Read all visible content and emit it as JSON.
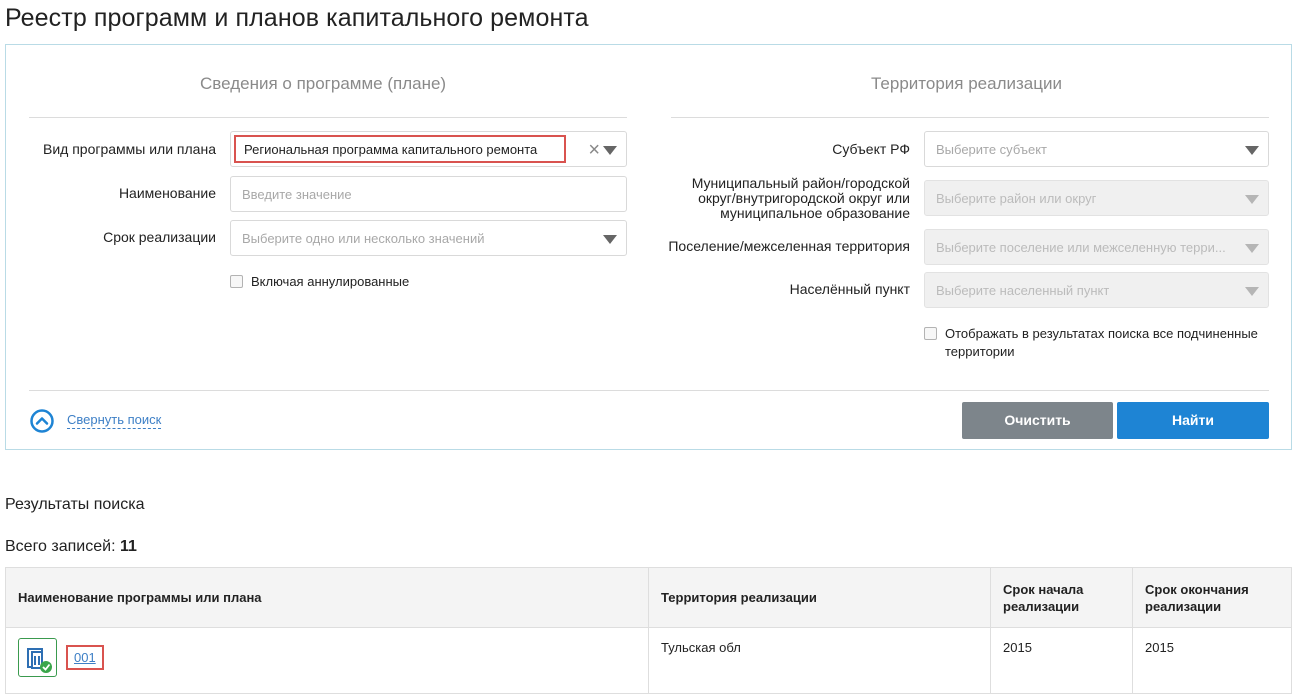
{
  "page": {
    "title": "Реестр программ и планов капитального ремонта"
  },
  "program_section": {
    "title": "Сведения о программе (плане)",
    "type_label": "Вид программы или плана",
    "type_value": "Региональная программа капитального ремонта",
    "name_label": "Наименование",
    "name_placeholder": "Введите значение",
    "period_label": "Срок реализации",
    "period_placeholder": "Выберите одно или несколько значений",
    "include_annulled_label": "Включая аннулированные"
  },
  "territory_section": {
    "title": "Территория реализации",
    "subject_label": "Субъект РФ",
    "subject_placeholder": "Выберите субъект",
    "district_label_lines": [
      "Муниципальный район/городской",
      "округ/внутригородской округ или",
      "муниципальное образование"
    ],
    "district_placeholder": "Выберите район или округ",
    "settlement_label": "Поселение/межселенная территория",
    "settlement_placeholder": "Выберите поселение или межселенную терри...",
    "locality_label": "Населённый пункт",
    "locality_placeholder": "Выберите населенный пункт",
    "show_subordinate_label_lines": [
      "Отображать в результатах поиска все подчиненные",
      "территории"
    ]
  },
  "actions": {
    "collapse_label": "Свернуть поиск",
    "clear_label": "Очистить",
    "find_label": "Найти"
  },
  "results": {
    "title": "Результаты поиска",
    "total_label": "Всего записей:",
    "total_count": "11",
    "columns": [
      "Наименование программы или плана",
      "Территория реализации",
      "Срок начала реализации",
      "Срок окончания реализации"
    ],
    "rows": [
      {
        "name": "001",
        "territory": "Тульская обл",
        "start": "2015",
        "end": "2015",
        "icon": "document-approved-icon"
      }
    ]
  },
  "colors": {
    "primary": "#1e84d4",
    "secondary": "#7d858b",
    "highlight": "#d9534f",
    "icon_green": "#3a9a4e"
  }
}
